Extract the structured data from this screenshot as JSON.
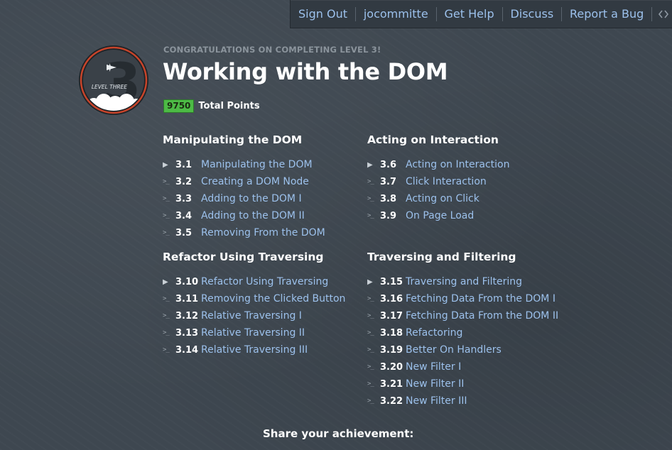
{
  "nav": {
    "items": [
      "Sign Out",
      "jocommitte",
      "Get Help",
      "Discuss",
      "Report a Bug"
    ],
    "toggle_icon": "code-brackets-icon"
  },
  "badge": {
    "big_number": "3",
    "label": "LEVEL THREE",
    "icon": "airplane-icon"
  },
  "header": {
    "congrats": "CONGRATULATIONS ON COMPLETING LEVEL 3!",
    "title": "Working with the DOM",
    "points_value": "9750",
    "points_label": "Total Points"
  },
  "sections": [
    {
      "title": "Manipulating the DOM",
      "items": [
        {
          "num": "3.1",
          "label": "Manipulating the DOM",
          "icon": "play-icon"
        },
        {
          "num": "3.2",
          "label": "Creating a DOM Node",
          "icon": "console-icon"
        },
        {
          "num": "3.3",
          "label": "Adding to the DOM I",
          "icon": "console-icon"
        },
        {
          "num": "3.4",
          "label": "Adding to the DOM II",
          "icon": "console-icon"
        },
        {
          "num": "3.5",
          "label": "Removing From the DOM",
          "icon": "console-icon"
        }
      ]
    },
    {
      "title": "Acting on Interaction",
      "items": [
        {
          "num": "3.6",
          "label": "Acting on Interaction",
          "icon": "play-icon"
        },
        {
          "num": "3.7",
          "label": "Click Interaction",
          "icon": "console-icon"
        },
        {
          "num": "3.8",
          "label": "Acting on Click",
          "icon": "console-icon"
        },
        {
          "num": "3.9",
          "label": "On Page Load",
          "icon": "console-icon"
        }
      ]
    },
    {
      "title": "Refactor Using Traversing",
      "items": [
        {
          "num": "3.10",
          "label": "Refactor Using Traversing",
          "icon": "play-icon"
        },
        {
          "num": "3.11",
          "label": "Removing the Clicked Button",
          "icon": "console-icon"
        },
        {
          "num": "3.12",
          "label": "Relative Traversing I",
          "icon": "console-icon"
        },
        {
          "num": "3.13",
          "label": "Relative Traversing II",
          "icon": "console-icon"
        },
        {
          "num": "3.14",
          "label": "Relative Traversing III",
          "icon": "console-icon"
        }
      ]
    },
    {
      "title": "Traversing and Filtering",
      "items": [
        {
          "num": "3.15",
          "label": "Traversing and Filtering",
          "icon": "play-icon"
        },
        {
          "num": "3.16",
          "label": "Fetching Data From the DOM I",
          "icon": "console-icon"
        },
        {
          "num": "3.17",
          "label": "Fetching Data From the DOM II",
          "icon": "console-icon"
        },
        {
          "num": "3.18",
          "label": "Refactoring",
          "icon": "console-icon"
        },
        {
          "num": "3.19",
          "label": "Better On Handlers",
          "icon": "console-icon"
        },
        {
          "num": "3.20",
          "label": "New Filter I",
          "icon": "console-icon"
        },
        {
          "num": "3.21",
          "label": "New Filter II",
          "icon": "console-icon"
        },
        {
          "num": "3.22",
          "label": "New Filter III",
          "icon": "console-icon"
        }
      ]
    }
  ],
  "footer": {
    "share": "Share your achievement:"
  },
  "colors": {
    "background": "#3e4750",
    "link": "#9cc1ec",
    "points_badge": "#4dbb46",
    "badge_ring": "#c8442a"
  }
}
